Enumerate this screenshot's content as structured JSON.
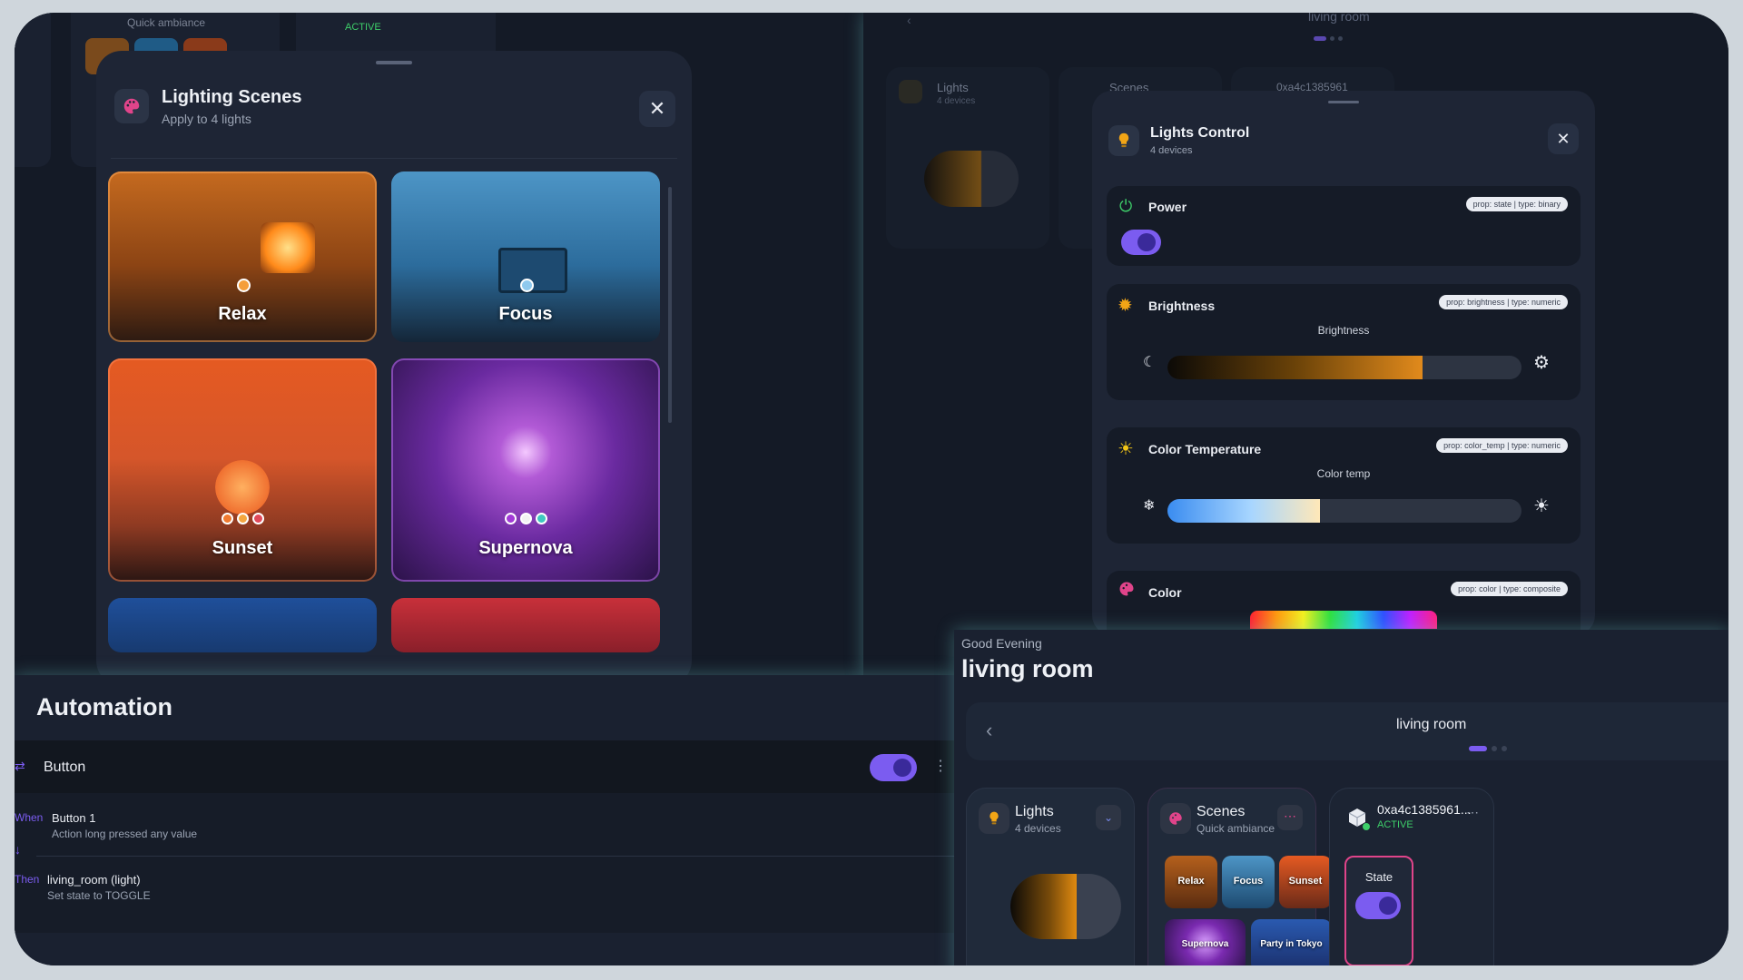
{
  "scenes_modal": {
    "title": "Lighting Scenes",
    "subtitle": "Apply to 4 lights",
    "tiles": [
      {
        "label": "Relax"
      },
      {
        "label": "Focus"
      },
      {
        "label": "Sunset"
      },
      {
        "label": "Supernova"
      }
    ]
  },
  "bg_top_left": {
    "subtitle": "Quick ambiance",
    "status": "ACTIVE"
  },
  "lights_control": {
    "title": "Lights Control",
    "subtitle": "4 devices",
    "power": {
      "label": "Power",
      "chip": "prop: state | type: binary",
      "on": true
    },
    "brightness": {
      "label": "Brightness",
      "chip": "prop: brightness | type: numeric",
      "caption": "Brightness",
      "level": 0.72
    },
    "color_temp": {
      "label": "Color Temperature",
      "chip": "prop: color_temp | type: numeric",
      "caption": "Color temp",
      "level": 0.43
    },
    "color": {
      "label": "Color",
      "chip": "prop: color | type: composite"
    }
  },
  "bg_top_right": {
    "header": "living room",
    "lights_title": "Lights",
    "lights_sub": "4 devices",
    "scenes_title": "Scenes",
    "device_id": "0xa4c1385961"
  },
  "automation": {
    "title": "Automation",
    "rule_name": "Button",
    "enabled": true,
    "when_tag": "When",
    "when_title": "Button 1",
    "when_desc": "Action long pressed any value",
    "then_tag": "Then",
    "then_title": "living_room (light)",
    "then_desc": "Set state to TOGGLE"
  },
  "dashboard": {
    "greeting": "Good Evening",
    "room_title": "living room",
    "nav_label": "living room",
    "lights_card": {
      "title": "Lights",
      "subtitle": "4 devices",
      "level": 0.6
    },
    "scenes_card": {
      "title": "Scenes",
      "subtitle": "Quick ambiance",
      "tiles": [
        "Relax",
        "Focus",
        "Sunset",
        "Supernova",
        "Party in Tokyo"
      ]
    },
    "device_card": {
      "name": "0xa4c1385961...",
      "status": "ACTIVE",
      "state_label": "State"
    }
  },
  "colors": {
    "accent": "#7b5cf0",
    "active_green": "#3ecf6a",
    "pink": "#e0448a",
    "amber": "#f2a516"
  },
  "icons": [
    "palette-icon",
    "close-icon",
    "bulb-icon",
    "power-icon",
    "brightness-icon",
    "sun-icon",
    "snowflake-icon",
    "moon-icon",
    "chevron-left-icon",
    "chevron-down-icon",
    "more-icon",
    "arrow-down-icon",
    "cube-icon",
    "shuffle-icon"
  ]
}
